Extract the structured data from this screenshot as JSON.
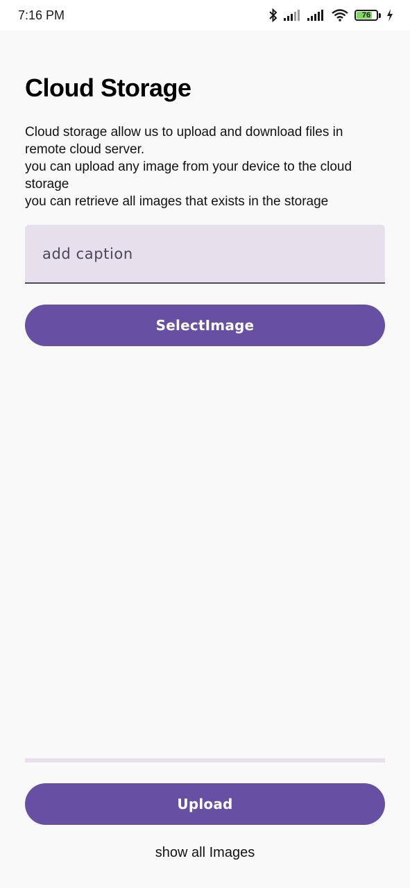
{
  "status_bar": {
    "time": "7:16 PM",
    "battery_level": "76",
    "icons": [
      "bluetooth-icon",
      "signal-icon",
      "signal-icon",
      "wifi-icon",
      "battery-icon",
      "charging-icon"
    ]
  },
  "page": {
    "title": "Cloud Storage",
    "description_lines": [
      "Cloud storage allow us to upload and download files in",
      "remote cloud server.",
      "you can upload any image from your device to the cloud",
      "storage",
      "you can retrieve all images that exists in the storage"
    ]
  },
  "caption": {
    "placeholder": "add caption",
    "value": ""
  },
  "buttons": {
    "select_image": "SelectImage",
    "upload": "Upload",
    "show_all_images": "show all Images"
  },
  "upload_progress": {
    "fraction": 0
  },
  "colors": {
    "primary": "#6750a4",
    "field_background": "#e8dfec",
    "page_background": "#f9f9f9"
  }
}
